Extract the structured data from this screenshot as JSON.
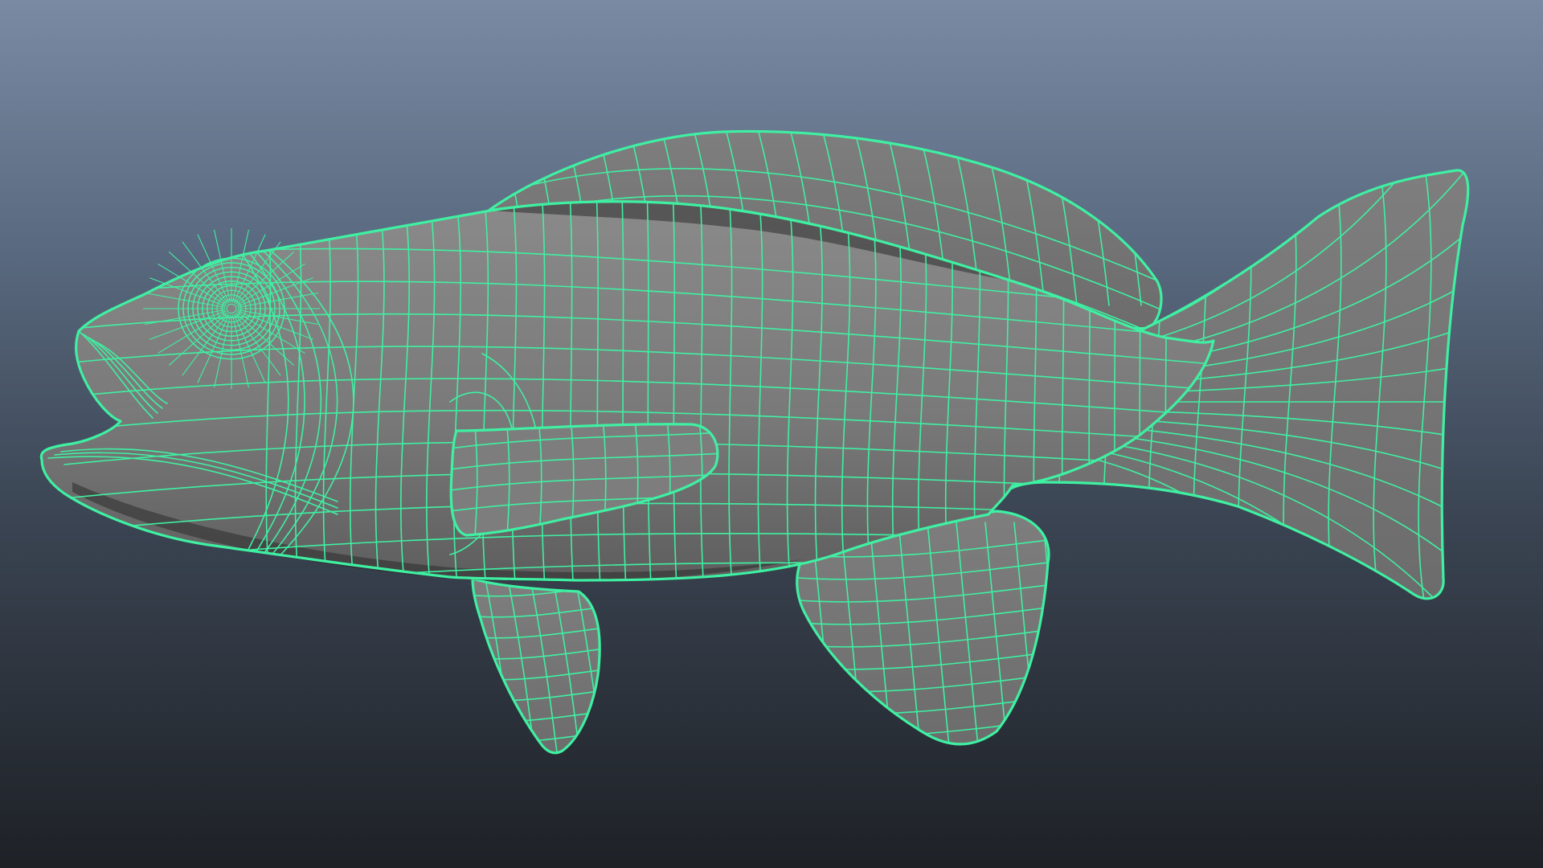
{
  "viewport": {
    "view_name": "perspective-viewport",
    "object": "fish-mesh",
    "display_mode": "wireframe-on-shaded",
    "colors": {
      "wireframe": "#3ff0a2",
      "surface": "#7b7b7b",
      "background_top": "#7a8aa3",
      "background_bottom": "#1e2126"
    }
  }
}
